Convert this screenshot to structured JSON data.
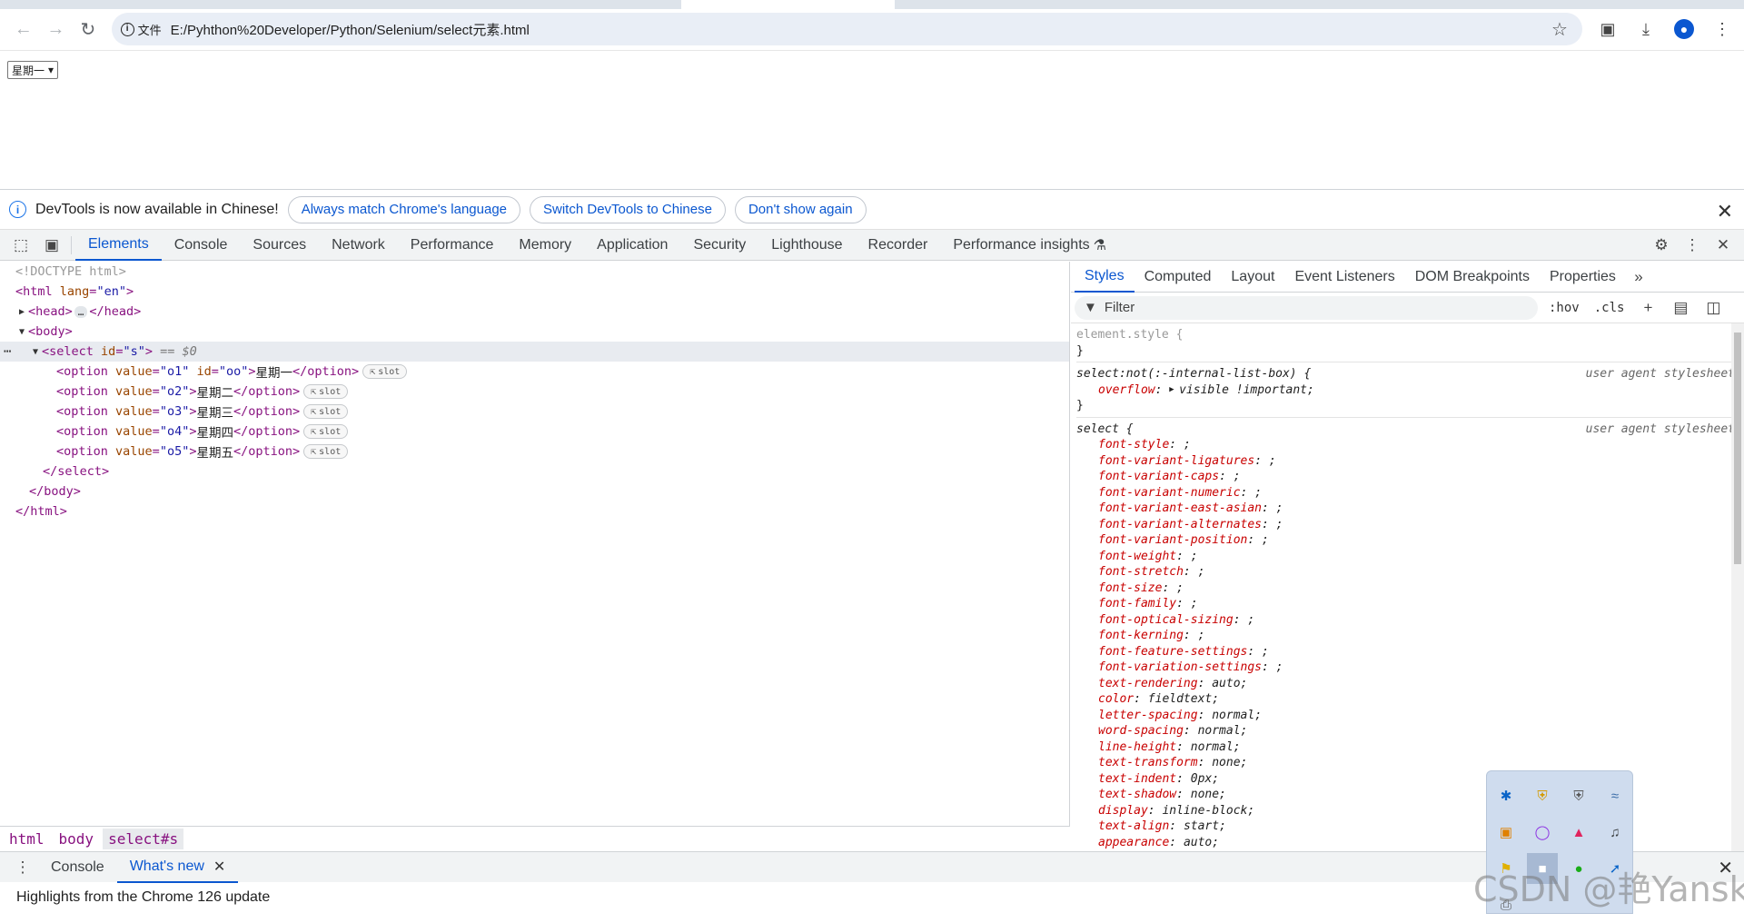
{
  "browser": {
    "site_info_label": "文件",
    "url": "E:/Pyhthon%20Developer/Python/Selenium/select元素.html"
  },
  "page": {
    "select_value": "星期一"
  },
  "devtools": {
    "infobar": {
      "message": "DevTools is now available in Chinese!",
      "btn_match": "Always match Chrome's language",
      "btn_switch": "Switch DevTools to Chinese",
      "btn_dont_show": "Don't show again"
    },
    "tabs": [
      "Elements",
      "Console",
      "Sources",
      "Network",
      "Performance",
      "Memory",
      "Application",
      "Security",
      "Lighthouse",
      "Recorder",
      "Performance insights"
    ],
    "dom": {
      "doctype": "<!DOCTYPE html>",
      "html_open_tag": "<html",
      "html_attr": "lang",
      "html_attr_val": "\"en\"",
      "head_open": "<head>",
      "head_close": "</head>",
      "body_open": "<body>",
      "select_open": "<select",
      "select_attr": "id",
      "select_attr_val": "\"s\"",
      "select_marker": "== $0",
      "options": [
        {
          "value": "\"o1\"",
          "extra_attr": "id",
          "extra_val": "\"oo\"",
          "text": "星期一"
        },
        {
          "value": "\"o2\"",
          "text": "星期二"
        },
        {
          "value": "\"o3\"",
          "text": "星期三"
        },
        {
          "value": "\"o4\"",
          "text": "星期四"
        },
        {
          "value": "\"o5\"",
          "text": "星期五"
        }
      ],
      "slot_label": "slot",
      "select_close": "</select>",
      "body_close": "</body>",
      "html_close": "</html>"
    },
    "breadcrumbs": [
      "html",
      "body",
      "select#s"
    ],
    "styles_tabs": [
      "Styles",
      "Computed",
      "Layout",
      "Event Listeners",
      "DOM Breakpoints",
      "Properties"
    ],
    "filter_placeholder": "Filter",
    "hov": ":hov",
    "cls": ".cls",
    "rules": {
      "element_style": "element.style {",
      "close_brace": "}",
      "rule1_selector": "select:not(:-internal-list-box) {",
      "rule1_origin": "user agent stylesheet",
      "rule1_decl": {
        "name": "overflow",
        "value": "visible !important;"
      },
      "rule2_selector": "select {",
      "rule2_origin": "user agent stylesheet",
      "rule2_decls": [
        {
          "name": "font-style",
          "value": ";"
        },
        {
          "name": "font-variant-ligatures",
          "value": ";"
        },
        {
          "name": "font-variant-caps",
          "value": ";"
        },
        {
          "name": "font-variant-numeric",
          "value": ";"
        },
        {
          "name": "font-variant-east-asian",
          "value": ";"
        },
        {
          "name": "font-variant-alternates",
          "value": ";"
        },
        {
          "name": "font-variant-position",
          "value": ";"
        },
        {
          "name": "font-weight",
          "value": ";"
        },
        {
          "name": "font-stretch",
          "value": ";"
        },
        {
          "name": "font-size",
          "value": ";"
        },
        {
          "name": "font-family",
          "value": ";"
        },
        {
          "name": "font-optical-sizing",
          "value": ";"
        },
        {
          "name": "font-kerning",
          "value": ";"
        },
        {
          "name": "font-feature-settings",
          "value": ";"
        },
        {
          "name": "font-variation-settings",
          "value": ";"
        },
        {
          "name": "text-rendering",
          "value": "auto;"
        },
        {
          "name": "color",
          "value": "fieldtext;"
        },
        {
          "name": "letter-spacing",
          "value": "normal;"
        },
        {
          "name": "word-spacing",
          "value": "normal;"
        },
        {
          "name": "line-height",
          "value": "normal;"
        },
        {
          "name": "text-transform",
          "value": "none;"
        },
        {
          "name": "text-indent",
          "value": "0px;"
        },
        {
          "name": "text-shadow",
          "value": "none;"
        },
        {
          "name": "display",
          "value": "inline-block;"
        },
        {
          "name": "text-align",
          "value": "start;"
        },
        {
          "name": "appearance",
          "value": "auto;"
        }
      ]
    },
    "drawer": {
      "tab_console": "Console",
      "tab_whats_new": "What's new",
      "content": "Highlights from the Chrome 126 update"
    }
  },
  "watermark": "CSDN @艳Yansky"
}
